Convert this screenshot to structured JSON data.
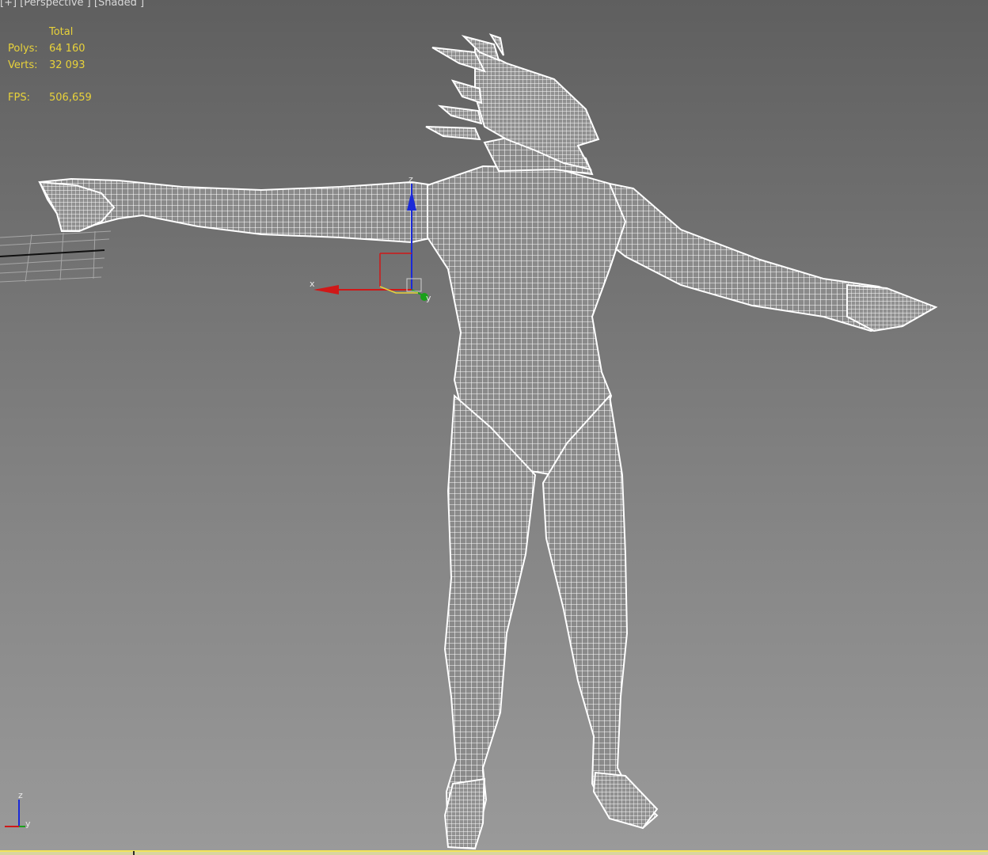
{
  "viewport": {
    "label": "[+] [Perspective ] [Shaded ]"
  },
  "statistics": {
    "header": "Total",
    "polys_label": "Polys:",
    "polys_value": "64 160",
    "verts_label": "Verts:",
    "verts_value": "32 093",
    "fps_label": "FPS:",
    "fps_value": "506,659"
  },
  "gizmo": {
    "x_label": "x",
    "y_label": "y",
    "z_label": "z"
  },
  "axis_tripod": {
    "z_label": "z",
    "y_label": "y"
  },
  "colors": {
    "stats_text": "#e8d23a",
    "axis_x": "#d01818",
    "axis_y": "#19a019",
    "axis_z": "#1a2ad8",
    "wireframe": "#ffffff"
  },
  "icons": {
    "transform_gizmo": "move-gizmo-icon",
    "view_axis": "axis-tripod-icon"
  }
}
